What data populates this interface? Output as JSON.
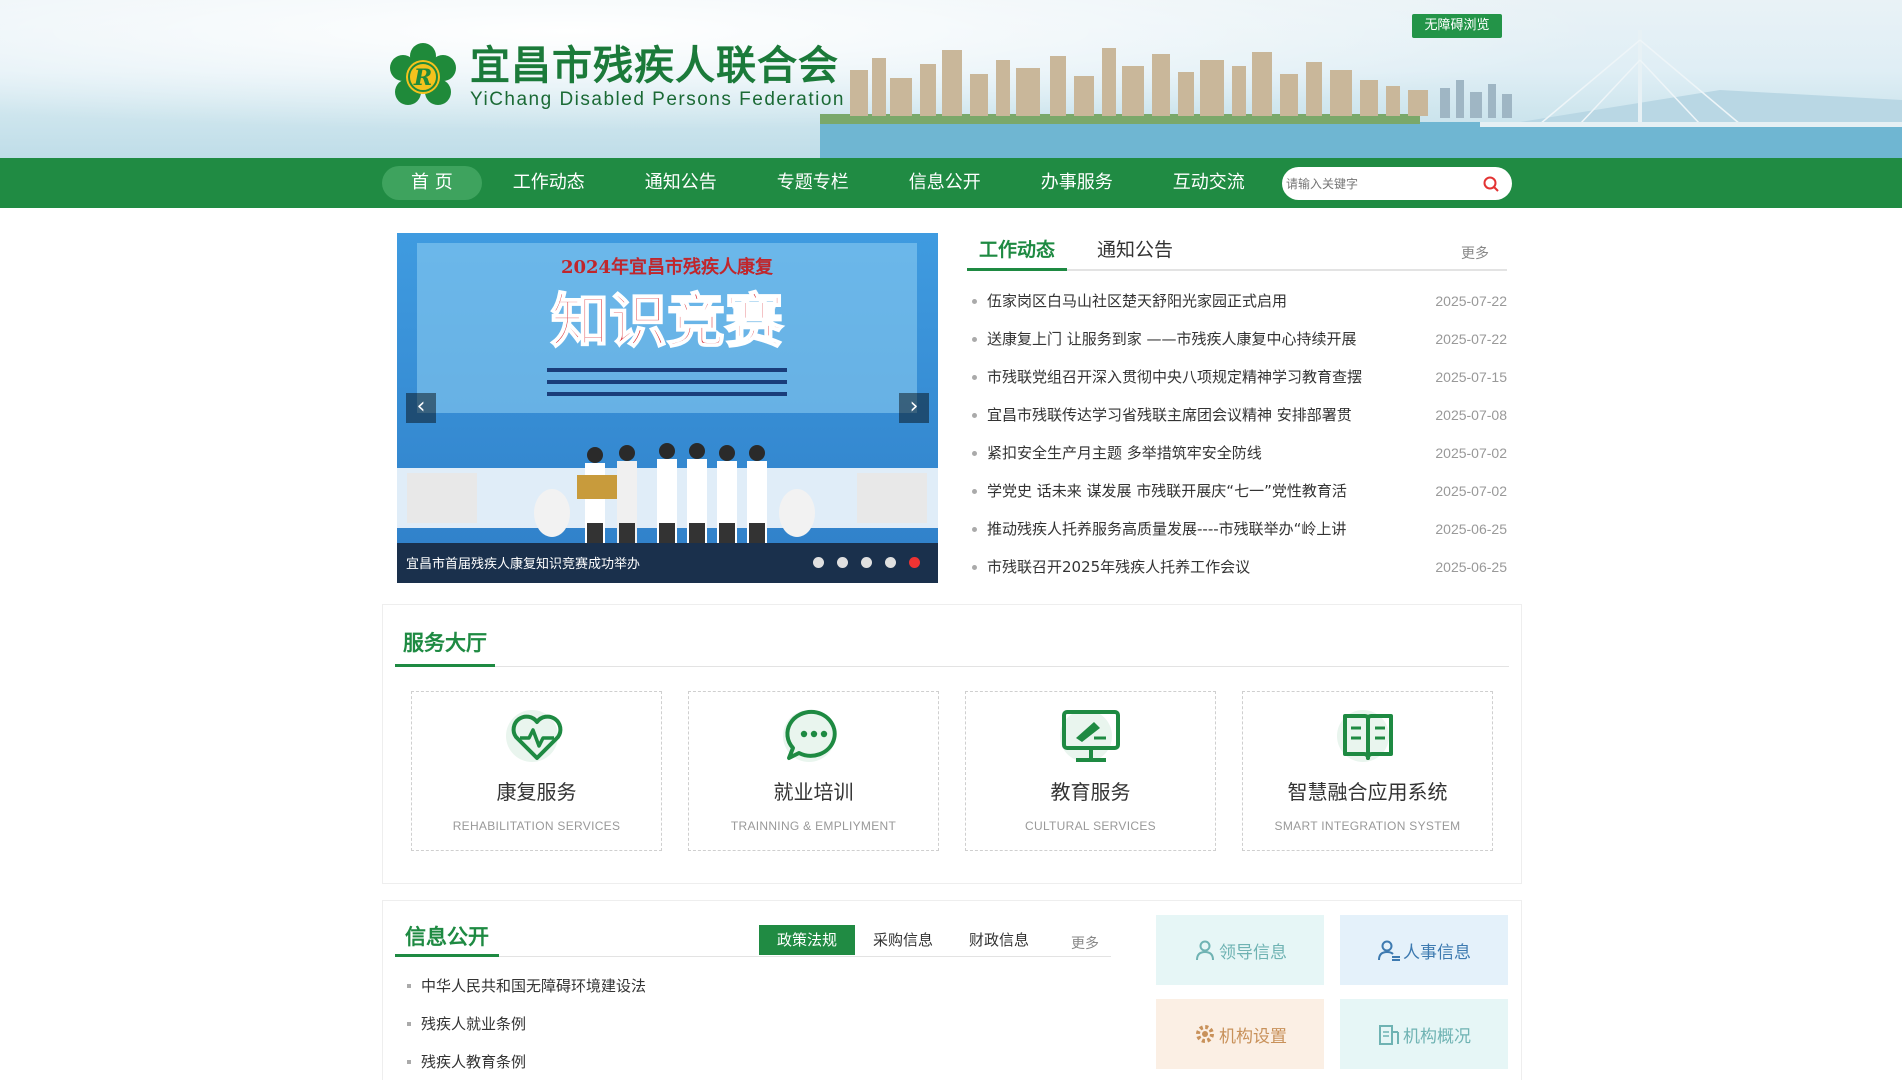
{
  "header": {
    "title_cn": "宜昌市残疾人联合会",
    "title_en": "YiChang Disabled Persons Federation",
    "accessibility_button": "无障碍浏览"
  },
  "nav": {
    "items": [
      "首 页",
      "工作动态",
      "通知公告",
      "专题专栏",
      "信息公开",
      "办事服务",
      "互动交流"
    ],
    "active_index": 0,
    "search_placeholder": "请输入关键字"
  },
  "slider": {
    "caption": "宜昌市首届残疾人康复知识竞赛成功举办",
    "slide_count": 5,
    "active_slide": 5,
    "banner_line1": "2024年宜昌市残疾人康复",
    "banner_line2": "知识竞赛"
  },
  "news": {
    "tabs": [
      "工作动态",
      "通知公告"
    ],
    "more": "更多",
    "items": [
      {
        "title": "伍家岗区白马山社区楚天舒阳光家园正式启用",
        "date": "2025-07-22"
      },
      {
        "title": "送康复上门 让服务到家 ——市残疾人康复中心持续开展",
        "date": "2025-07-22"
      },
      {
        "title": "市残联党组召开深入贯彻中央八项规定精神学习教育查摆",
        "date": "2025-07-15"
      },
      {
        "title": "宜昌市残联传达学习省残联主席团会议精神 安排部署贯",
        "date": "2025-07-08"
      },
      {
        "title": "紧扣安全生产月主题 多举措筑牢安全防线",
        "date": "2025-07-02"
      },
      {
        "title": "学党史 话未来 谋发展 市残联开展庆“七一”党性教育活",
        "date": "2025-07-02"
      },
      {
        "title": "推动残疾人托养服务高质量发展----市残联举办“岭上讲",
        "date": "2025-06-25"
      },
      {
        "title": "市残联召开2025年残疾人托养工作会议",
        "date": "2025-06-25"
      }
    ]
  },
  "service_hall": {
    "title": "服务大厅",
    "cards": [
      {
        "name": "康复服务",
        "en": "REHABILITATION SERVICES",
        "icon": "heart-pulse-icon"
      },
      {
        "name": "就业培训",
        "en": "TRAINNING & EMPLIYMENT",
        "icon": "chat-bubble-icon"
      },
      {
        "name": "教育服务",
        "en": "CULTURAL SERVICES",
        "icon": "monitor-icon"
      },
      {
        "name": "智慧融合应用系统",
        "en": "SMART INTEGRATION SYSTEM",
        "icon": "book-icon"
      }
    ]
  },
  "info_public": {
    "title": "信息公开",
    "tabs": [
      "政策法规",
      "采购信息",
      "财政信息"
    ],
    "active_tab": 0,
    "more": "更多",
    "items": [
      "中华人民共和国无障碍环境建设法",
      "残疾人就业条例",
      "残疾人教育条例"
    ],
    "quick_links": [
      {
        "label": "领导信息",
        "icon": "person-icon",
        "color": "#e6f6f6"
      },
      {
        "label": "人事信息",
        "icon": "person-list-icon",
        "color": "#e4f1fa"
      },
      {
        "label": "机构设置",
        "icon": "gear-icon",
        "color": "#fbefe4"
      },
      {
        "label": "机构概况",
        "icon": "document-icon",
        "color": "#e6f6f6"
      }
    ]
  },
  "colors": {
    "primary_green": "#208b43",
    "accent_red": "#e33333"
  }
}
